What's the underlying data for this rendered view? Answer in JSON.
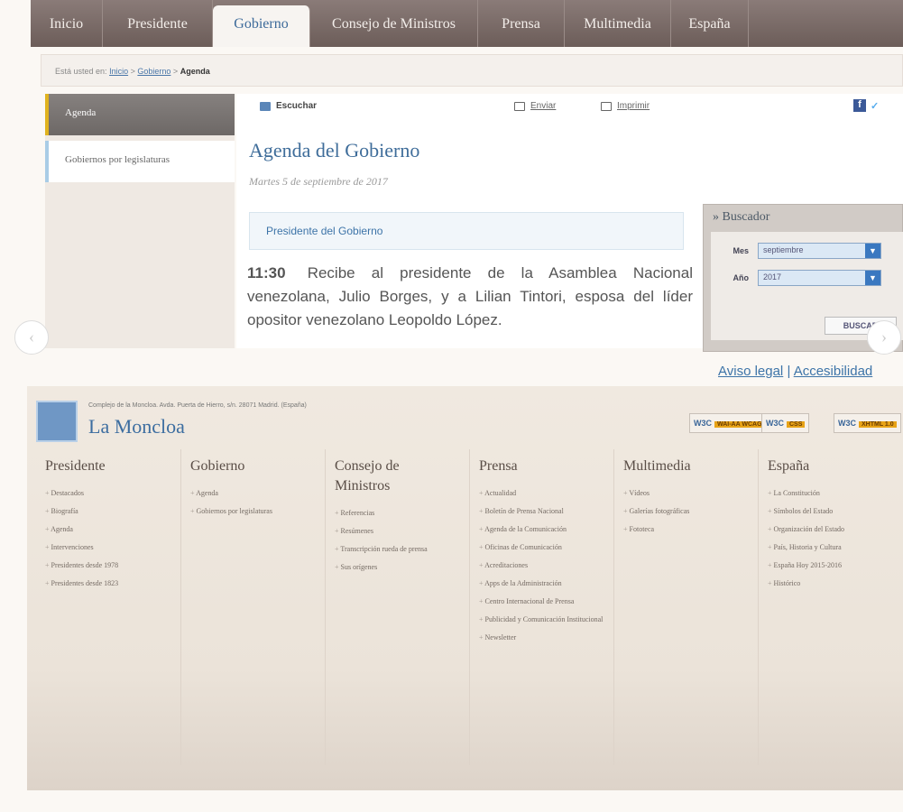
{
  "nav": {
    "tabs": [
      "Inicio",
      "Presidente",
      "Gobierno",
      "Consejo de Ministros",
      "Prensa",
      "Multimedia",
      "España"
    ],
    "active": "Gobierno"
  },
  "breadcrumb": {
    "label": "Está usted en:",
    "items": [
      "Inicio",
      "Gobierno"
    ],
    "current": "Agenda",
    "sep": ">"
  },
  "sidebar": {
    "items": [
      "Agenda",
      "Gobiernos por legislaturas"
    ]
  },
  "toolbar": {
    "listen": "Escuchar",
    "send": "Enviar",
    "print": "Imprimir"
  },
  "main": {
    "title": "Agenda del Gobierno",
    "date": "Martes 5 de septiembre de 2017",
    "section": "Presidente del Gobierno",
    "event_time": "11:30",
    "event_text": "Recibe al presidente de la Asamblea Nacional venezolana, Julio Borges, y a Lilian Tintori, esposa del líder opositor venezolano Leopoldo López."
  },
  "buscador": {
    "title": "» Buscador",
    "month_label": "Mes",
    "month_value": "septiembre",
    "year_label": "Año",
    "year_value": "2017",
    "button": "BUSCAR"
  },
  "legal": {
    "aviso": "Aviso legal",
    "sep": "|",
    "acces": "Accesibilidad"
  },
  "footer": {
    "address": "Complejo de la Moncloa. Avda. Puerta de Hierro, s/n. 28071 Madrid. (España)",
    "brand": "La Moncloa",
    "badges": [
      {
        "w": "W3C",
        "b": "WAI-AA WCAG 1.0"
      },
      {
        "w": "W3C",
        "b": "CSS"
      },
      {
        "w": "W3C",
        "b": "XHTML 1.0"
      }
    ],
    "columns": [
      {
        "title": "Presidente",
        "items": [
          "Destacados",
          "Biografía",
          "Agenda",
          "Intervenciones",
          "Presidentes desde 1978",
          "Presidentes desde 1823"
        ]
      },
      {
        "title": "Gobierno",
        "items": [
          "Agenda",
          "Gobiernos por legislaturas"
        ]
      },
      {
        "title": "Consejo de Ministros",
        "items": [
          "Referencias",
          "Resúmenes",
          "Transcripción rueda de prensa",
          "Sus orígenes"
        ]
      },
      {
        "title": "Prensa",
        "items": [
          "Actualidad",
          "Boletín de Prensa Nacional",
          "Agenda de la Comunicación",
          "Oficinas de Comunicación",
          "Acreditaciones",
          "Apps de la Administración",
          "Centro Internacional de Prensa",
          "Publicidad y Comunicación Institucional",
          "Newsletter"
        ]
      },
      {
        "title": "Multimedia",
        "items": [
          "Vídeos",
          "Galerías fotográficas",
          "Fototeca"
        ]
      },
      {
        "title": "España",
        "items": [
          "La Constitución",
          "Símbolos del Estado",
          "Organización del Estado",
          "País, Historia y Cultura",
          "España Hoy 2015-2016",
          "Histórico"
        ]
      }
    ]
  },
  "colors": {
    "nav_bg": "#7a6b67",
    "accent": "#3d74a8",
    "highlight": "#e0b31f"
  }
}
